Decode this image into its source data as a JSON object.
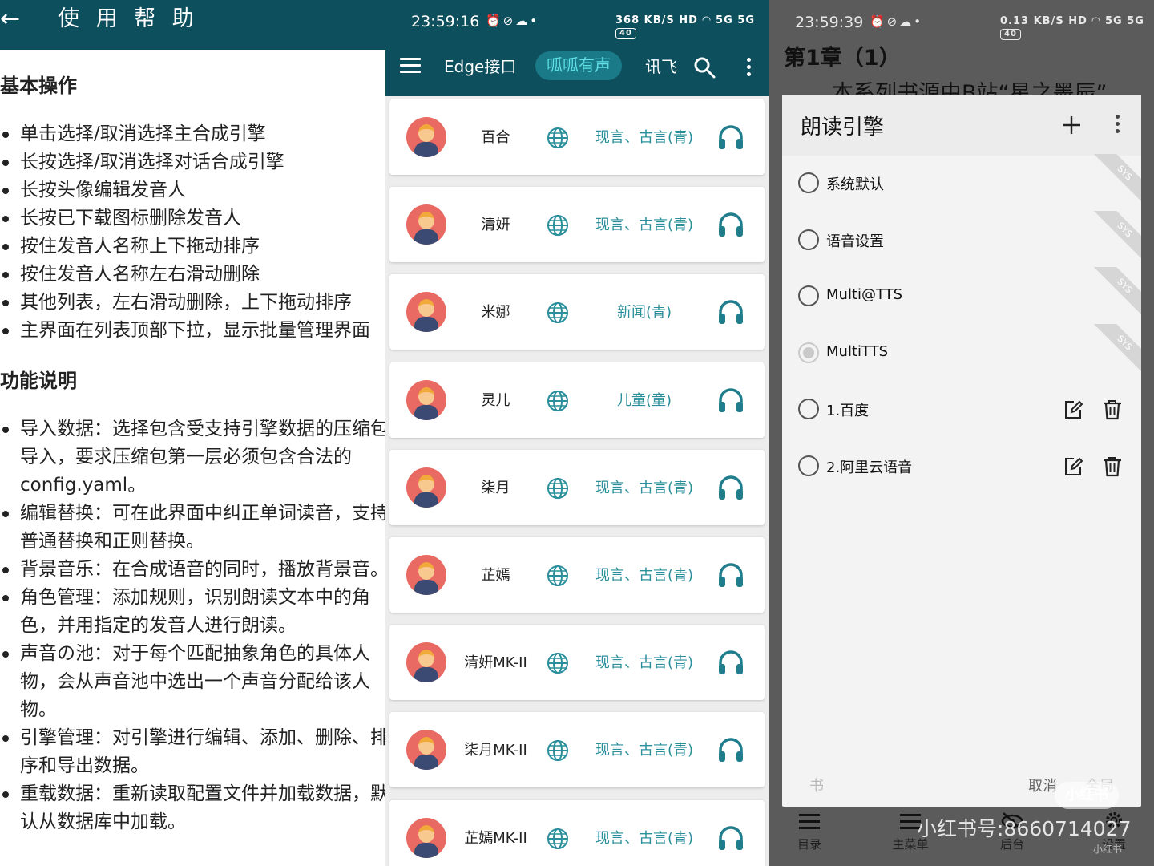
{
  "help": {
    "title": "使 用 帮 助",
    "back_icon": "←",
    "section1": {
      "heading": "基本操作",
      "items": [
        "单击选择/取消选择主合成引擎",
        "长按选择/取消选择对话合成引擎",
        "长按头像编辑发音人",
        "长按已下载图标删除发音人",
        "按住发音人名称上下拖动排序",
        "按住发音人名称左右滑动删除",
        "其他列表，左右滑动删除，上下拖动排序",
        "主界面在列表顶部下拉，显示批量管理界面"
      ]
    },
    "section2": {
      "heading": "功能说明",
      "items": [
        "导入数据：选择包含受支持引擎数据的压缩包导入，要求压缩包第一层必须包含合法的config.yaml。",
        "编辑替换：可在此界面中纠正单词读音，支持普通替换和正则替换。",
        "背景音乐：在合成语音的同时，播放背景音。",
        "角色管理：添加规则，识别朗读文本中的角色，并用指定的发音人进行朗读。",
        "声音の池：对于每个匹配抽象角色的具体人物，会从声音池中选出一个声音分配给该人物。",
        "引擎管理：对引擎进行编辑、添加、删除、排序和导出数据。",
        "重载数据：重新读取配置文件并加载数据，默认从数据库中加载。"
      ]
    }
  },
  "voices": {
    "status": {
      "time": "23:59:16",
      "left_icons": "⏰⊘☁•",
      "net_speed": "368 KB/S",
      "hd": "HD",
      "signal": "5G 5G",
      "battery": "40"
    },
    "tabs": [
      "Edge接口",
      "呱呱有声",
      "讯飞"
    ],
    "active_tab": "呱呱有声",
    "accent": "#0d4f5c",
    "items": [
      {
        "name": "百合",
        "tags": "现言、古言(青)"
      },
      {
        "name": "清妍",
        "tags": "现言、古言(青)"
      },
      {
        "name": "米娜",
        "tags": "新闻(青)"
      },
      {
        "name": "灵儿",
        "tags": "儿童(童)"
      },
      {
        "name": "柒月",
        "tags": "现言、古言(青)"
      },
      {
        "name": "芷嫣",
        "tags": "现言、古言(青)"
      },
      {
        "name": "清妍MK-II",
        "tags": "现言、古言(青)"
      },
      {
        "name": "柒月MK-II",
        "tags": "现言、古言(青)"
      },
      {
        "name": "芷嫣MK-II",
        "tags": "现言、古言(青)"
      }
    ]
  },
  "engine": {
    "status": {
      "time": "23:59:39",
      "left_icons": "⏰⊘☁•",
      "net_speed": "0.13 KB/S",
      "hd": "HD",
      "signal": "5G 5G",
      "battery": "40"
    },
    "chapter": "第1章（1）",
    "body_text": "本系列书源由B站“星之墨辰”",
    "dialog_title": "朗读引擎",
    "sys_label": "SYS",
    "engines": [
      {
        "name": "系统默认",
        "sys": true,
        "selected": false,
        "editable": false
      },
      {
        "name": "语音设置",
        "sys": true,
        "selected": false,
        "editable": false
      },
      {
        "name": "Multi@TTS",
        "sys": true,
        "selected": false,
        "editable": false
      },
      {
        "name": "MultiTTS",
        "sys": true,
        "selected": true,
        "editable": false
      },
      {
        "name": "1.百度",
        "sys": false,
        "selected": false,
        "editable": true
      },
      {
        "name": "2.阿里云语音",
        "sys": false,
        "selected": false,
        "editable": true
      }
    ],
    "footer": {
      "left": "书",
      "cancel": "取消",
      "all": "全局"
    },
    "nav": [
      {
        "label": "目录",
        "icon": "toc-icon"
      },
      {
        "label": "主菜单",
        "icon": "menu-icon"
      },
      {
        "label": "后台",
        "icon": "eye-off-icon"
      },
      {
        "label": "设置",
        "icon": "gear-icon"
      }
    ],
    "watermark": "小红书号:8660714027",
    "watermark_badge": "小红书"
  }
}
